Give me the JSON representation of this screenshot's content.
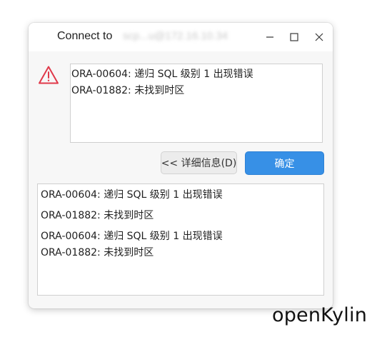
{
  "window": {
    "title_prefix": "Connect to",
    "title_host_blurred": "scp...u@172.16.10.34"
  },
  "dialog": {
    "icon": "warning-icon",
    "messages": [
      "ORA-00604: 递归 SQL 级别 1 出现错误",
      "ORA-01882: 未找到时区"
    ],
    "buttons": {
      "details_label": "<< 详细信息(D)",
      "ok_label": "确定"
    },
    "details": [
      "ORA-00604: 递归 SQL 级别 1 出现错误",
      "ORA-01882: 未找到时区",
      "ORA-00604: 递归 SQL 级别 1 出现错误",
      "ORA-01882: 未找到时区"
    ]
  },
  "desktop": {
    "watermark": "openKylin"
  },
  "colors": {
    "accent": "#3790e6",
    "warning": "#e0394a",
    "dialog_bg": "#f7f7f7"
  }
}
